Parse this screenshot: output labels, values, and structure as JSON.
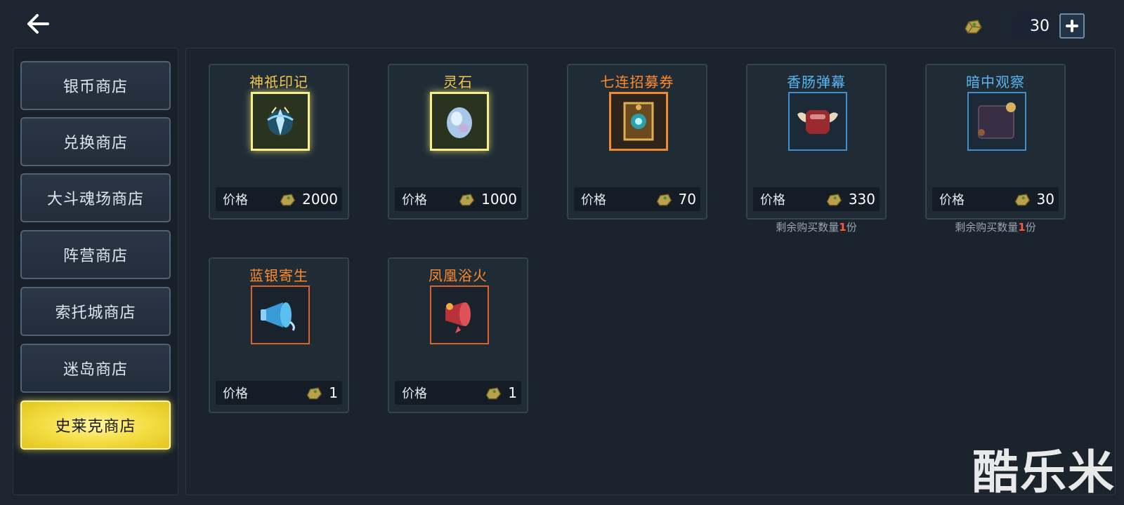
{
  "header": {
    "back_icon": "arrow-left-icon",
    "currency_amount": "30",
    "currency_icon": "gold-ingot-icon"
  },
  "sidebar": {
    "tabs": [
      {
        "label": "银币商店",
        "active": false
      },
      {
        "label": "兑换商店",
        "active": false
      },
      {
        "label": "大斗魂场商店",
        "active": false
      },
      {
        "label": "阵营商店",
        "active": false
      },
      {
        "label": "索托城商店",
        "active": false
      },
      {
        "label": "迷岛商店",
        "active": false
      },
      {
        "label": "史莱克商店",
        "active": true
      }
    ]
  },
  "shop": {
    "price_label": "价格",
    "remain_prefix": "剩余购买数量",
    "remain_suffix": "份",
    "items": [
      {
        "name": "神祇印记",
        "name_color": "#f5c84a",
        "frame": "#f7f08a",
        "icon": "divine-seal-icon",
        "price": "2000"
      },
      {
        "name": "灵石",
        "name_color": "#f5c84a",
        "frame": "#f7f08a",
        "icon": "spirit-stone-icon",
        "price": "1000"
      },
      {
        "name": "七连招募券",
        "name_color": "#ff8a2a",
        "frame": "#f08a2c",
        "icon": "recruit-ticket-icon",
        "price": "70"
      },
      {
        "name": "香肠弹幕",
        "name_color": "#5ab4f0",
        "frame": "#3f8fcf",
        "icon": "sausage-bubble-icon",
        "price": "330",
        "remain": "1"
      },
      {
        "name": "暗中观察",
        "name_color": "#5ab4f0",
        "frame": "#3f8fcf",
        "icon": "secret-observe-frame-icon",
        "price": "30",
        "remain": "1"
      },
      {
        "name": "蓝银寄生",
        "name_color": "#ff8a2a",
        "frame": "#d8642a",
        "icon": "blue-silver-horn-icon",
        "price": "1"
      },
      {
        "name": "凤凰浴火",
        "name_color": "#ff8a2a",
        "frame": "#d8642a",
        "icon": "phoenix-horn-icon",
        "price": "1"
      }
    ]
  },
  "watermark": "酷乐米"
}
